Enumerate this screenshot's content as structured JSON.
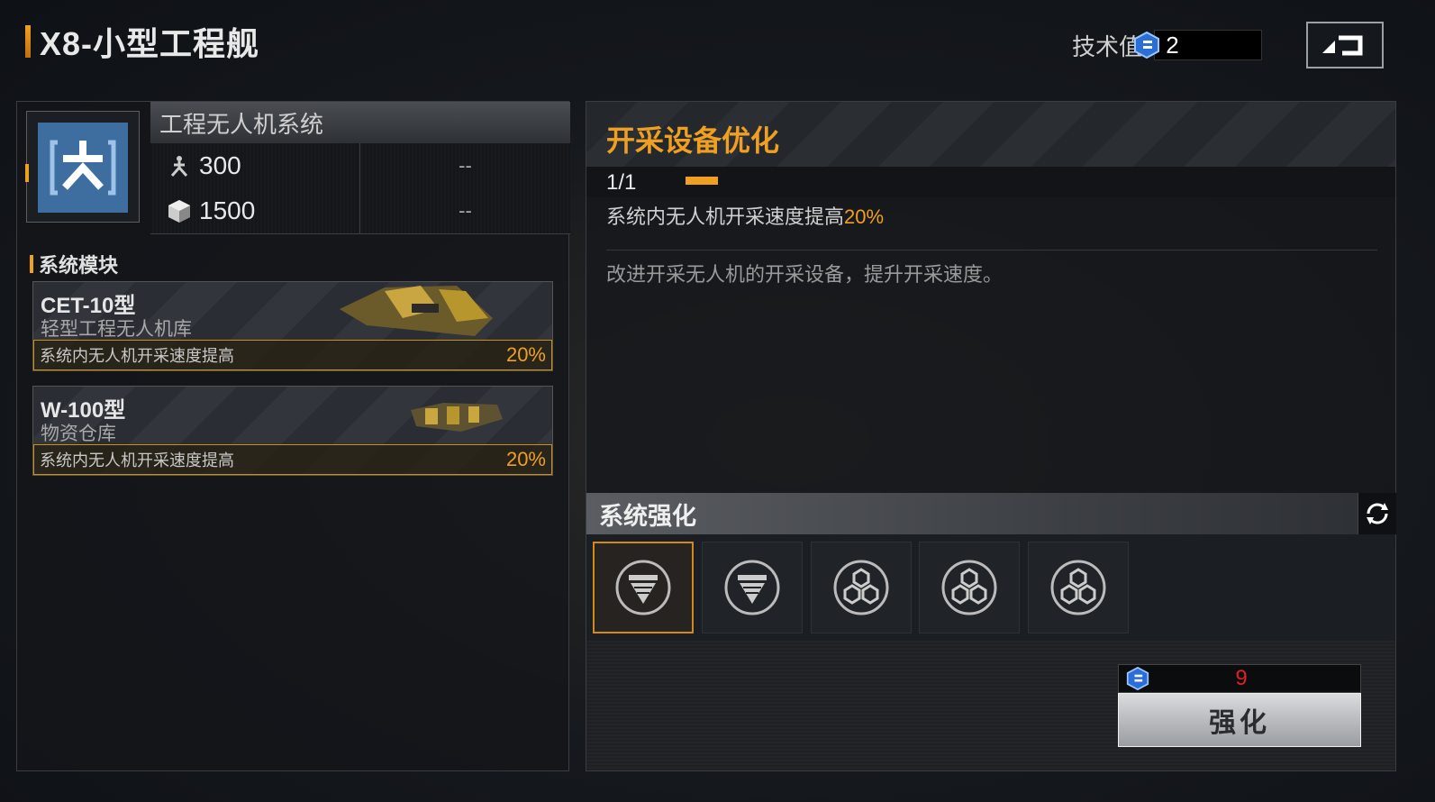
{
  "header": {
    "title": "X8-小型工程舰",
    "tech_label": "技术值:",
    "tech_value": "2"
  },
  "system": {
    "name": "工程无人机系统",
    "stats": [
      {
        "icon": "drone-icon",
        "value": "300",
        "extra": "--"
      },
      {
        "icon": "cube-icon",
        "value": "1500",
        "extra": "--"
      }
    ]
  },
  "modules": {
    "title": "系统模块",
    "items": [
      {
        "name": "CET-10型",
        "sub": "轻型工程无人机库",
        "effect": "系统内无人机开采速度提高",
        "value": "20%"
      },
      {
        "name": "W-100型",
        "sub": "物资仓库",
        "effect": "系统内无人机开采速度提高",
        "value": "20%"
      }
    ]
  },
  "detail": {
    "title": "开采设备优化",
    "level": "1/1",
    "effect_prefix": "系统内无人机开采速度提高",
    "effect_value": "20%",
    "description": "改进开采无人机的开采设备，提升开采速度。"
  },
  "enhance": {
    "title": "系统强化",
    "slots": [
      "drill-icon",
      "drill-icon",
      "hex-cluster-icon",
      "hex-cluster-icon",
      "hex-cluster-icon"
    ],
    "cost": "9",
    "button_label": "强化"
  },
  "colors": {
    "accent": "#f0a020",
    "cost": "#e02020",
    "icon_blue": "#3e6ea0"
  }
}
